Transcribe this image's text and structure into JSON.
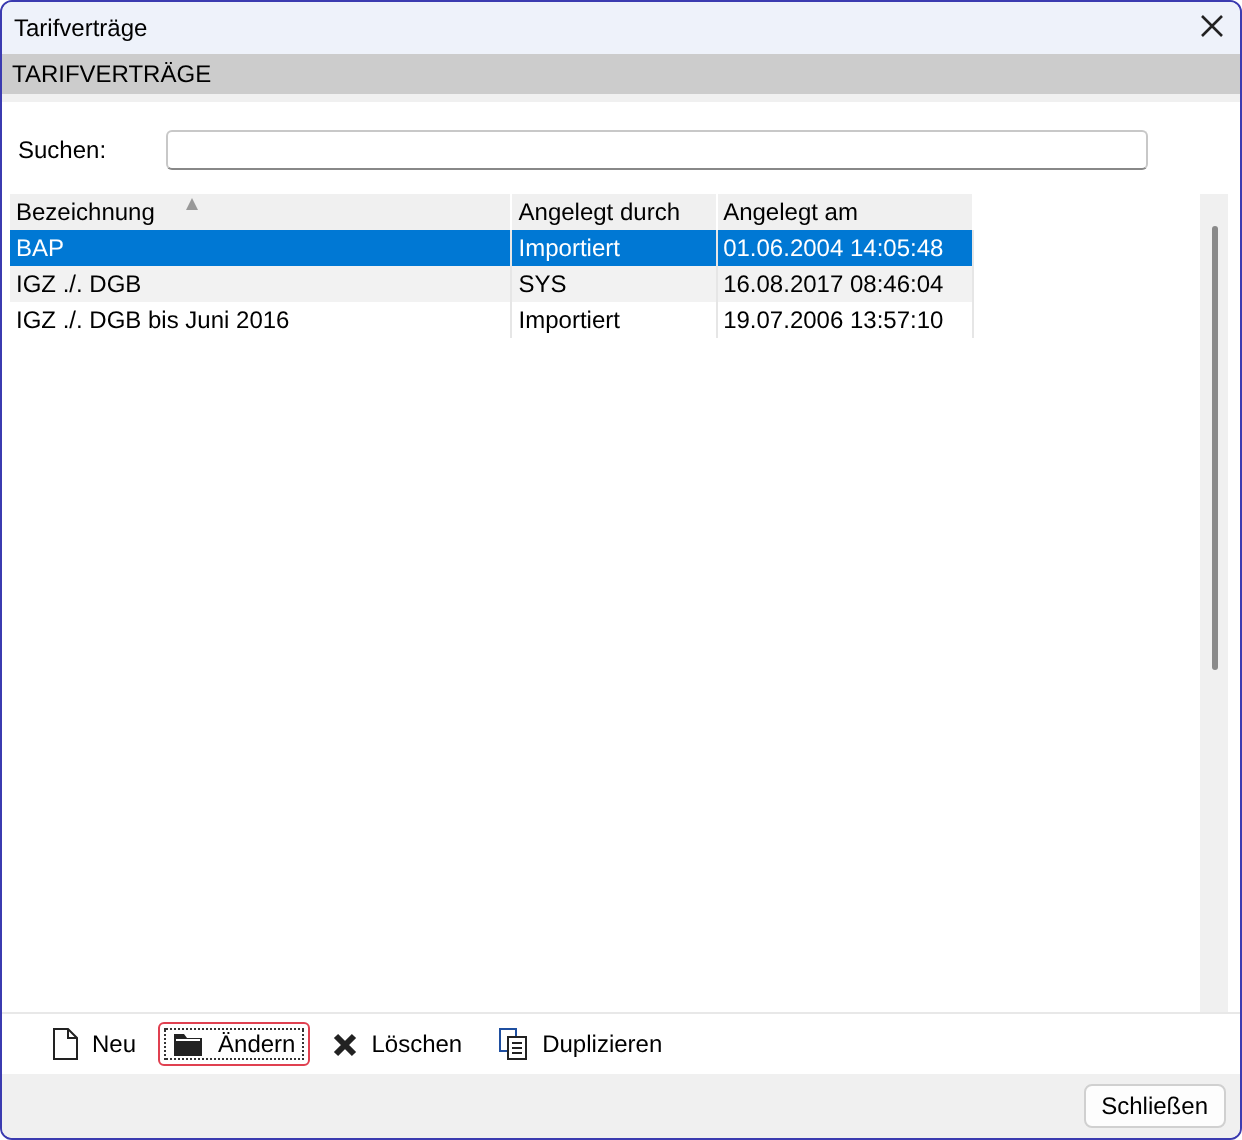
{
  "window": {
    "title": "Tarifverträge"
  },
  "section": {
    "title": "TARIFVERTRÄGE"
  },
  "search": {
    "label": "Suchen:"
  },
  "table": {
    "columns": [
      {
        "label": "Bezeichnung",
        "sorted": true
      },
      {
        "label": "Angelegt durch",
        "sorted": false
      },
      {
        "label": "Angelegt am",
        "sorted": false
      }
    ],
    "rows": [
      {
        "selected": true,
        "cells": [
          "BAP",
          "Importiert",
          "01.06.2004 14:05:48"
        ]
      },
      {
        "selected": false,
        "cells": [
          "IGZ ./. DGB",
          "SYS",
          "16.08.2017 08:46:04"
        ]
      },
      {
        "selected": false,
        "cells": [
          "IGZ ./. DGB bis Juni 2016",
          "Importiert",
          "19.07.2006 13:57:10"
        ]
      }
    ]
  },
  "toolbar": [
    {
      "kind": "new",
      "label": "Neu",
      "focused": false
    },
    {
      "kind": "edit",
      "label": "Ändern",
      "focused": true
    },
    {
      "kind": "delete",
      "label": "Löschen",
      "focused": false
    },
    {
      "kind": "duplicate",
      "label": "Duplizieren",
      "focused": false
    }
  ],
  "footer": {
    "close_button": "Schließen"
  }
}
